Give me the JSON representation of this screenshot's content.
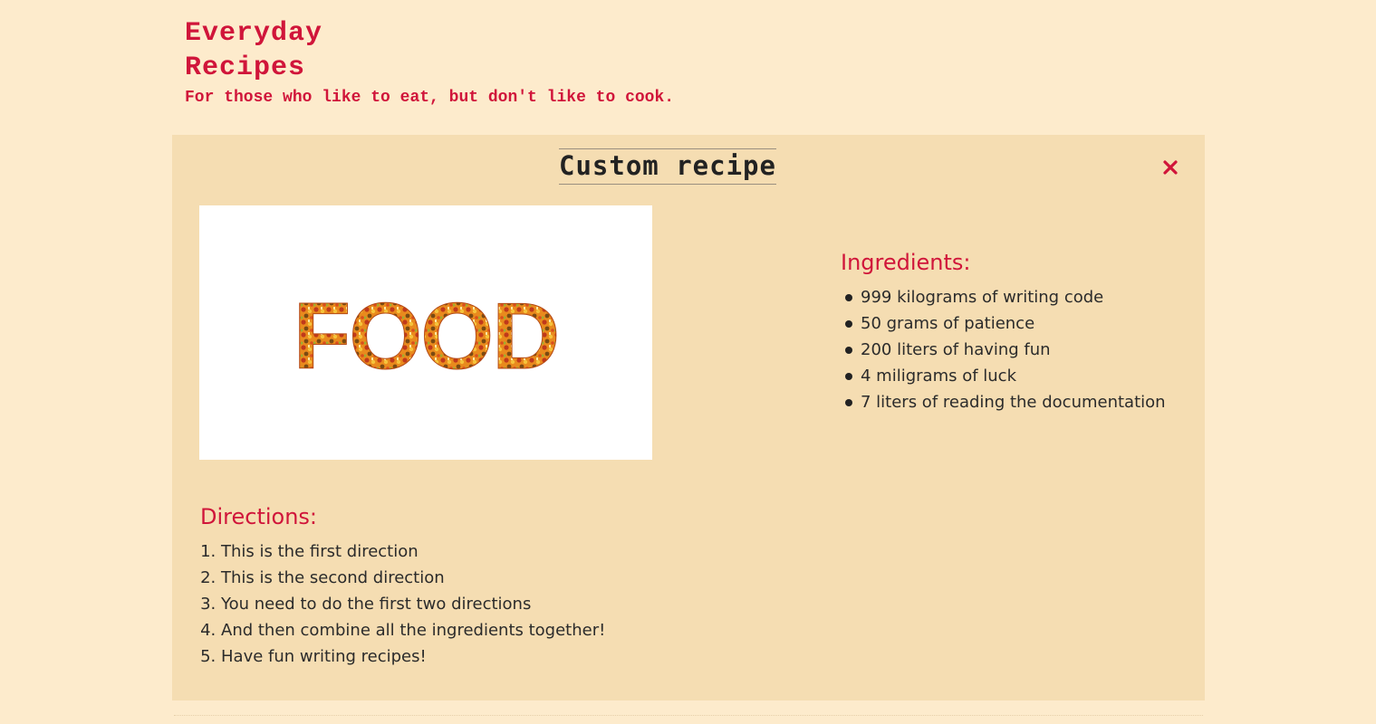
{
  "site": {
    "title": "Everyday Recipes",
    "tagline": "For those who like to eat, but don't like to cook.",
    "accent_color": "#d0153a",
    "background_color": "#fdebcc"
  },
  "recipe": {
    "title": "Custom recipe",
    "close_icon": "close-icon",
    "card_color": "#f5ddb2",
    "image_text": "FOOD",
    "ingredients_heading": "Ingredients:",
    "ingredients": [
      "999 kilograms of writing code",
      "50 grams of patience",
      "200 liters of having fun",
      "4 miligrams of luck",
      "7 liters of reading the documentation"
    ],
    "directions_heading": "Directions:",
    "directions": [
      "This is the first direction",
      "This is the second direction",
      "You need to do the first two directions",
      "And then combine all the ingredients together!",
      "Have fun writing recipes!"
    ]
  }
}
